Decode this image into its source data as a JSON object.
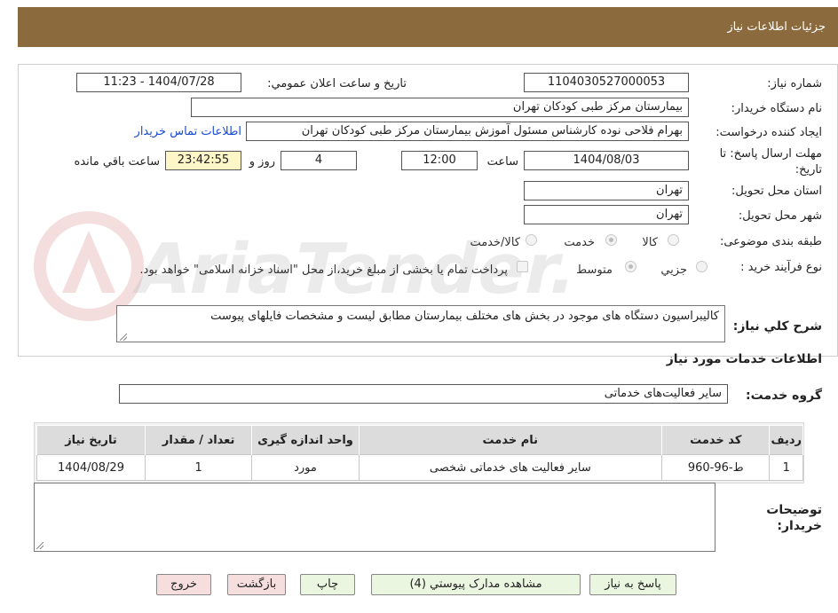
{
  "header": {
    "title": "جزئیات اطلاعات نیاز"
  },
  "form": {
    "need_number_label": "شماره نیاز:",
    "need_number": "1104030527000053",
    "announce_label": "تاريخ و ساعت اعلان عمومي:",
    "announce_value": "1404/07/28 - 11:23",
    "buyer_org_label": "نام دستگاه خريدار:",
    "buyer_org": "بیمارستان مرکز طبی کودکان تهران",
    "creator_label": "ايجاد کننده درخواست:",
    "creator": "بهرام فلاحی نوده کارشناس مسئول آموزش بیمارستان مرکز طبی کودکان تهران",
    "contact_link": "اطلاعات تماس خريدار",
    "deadline_label": "مهلت ارسال پاسخ: تا تاریخ:",
    "deadline_date": "1404/08/03",
    "hour_label": "ساعت",
    "deadline_time": "12:00",
    "days_value": "4",
    "days_label": "روز و",
    "remaining_time": "23:42:55",
    "remaining_label": "ساعت باقي مانده",
    "province_label": "استان محل تحویل:",
    "province": "تهران",
    "city_label": "شهر محل تحویل:",
    "city": "تهران",
    "category_label": "طبقه بندی موضوعی:",
    "category_options": [
      "کالا",
      "خدمت",
      "کالا/خدمت"
    ],
    "category_selected": "خدمت",
    "process_label": "نوع فرآیند خرید :",
    "process_options": [
      "جزيي",
      "متوسط"
    ],
    "process_selected": "متوسط",
    "payment_note": "پرداخت تمام یا بخشی از مبلغ خرید،از محل \"اسناد خزانه اسلامی\" خواهد بود."
  },
  "description": {
    "label": "شرح کلي نياز:",
    "text": "کالیبراسیون دستگاه های موجود در بخش های مختلف بیمارستان مطابق لیست و مشخصات فایلهای پیوست"
  },
  "services": {
    "section_title": "اطلاعات خدمات مورد نياز",
    "group_label": "گروه خدمت:",
    "group_value": "سایر فعالیت‌های خدماتی",
    "columns": [
      "رديف",
      "کد خدمت",
      "نام خدمت",
      "واحد اندازه گيری",
      "تعداد / مقدار",
      "تاريخ نياز"
    ],
    "rows": [
      [
        "1",
        "ط-96-960",
        "سایر فعالیت های خدماتی شخصی",
        "مورد",
        "1",
        "1404/08/29"
      ]
    ]
  },
  "notes": {
    "label": "توضيحات خريدار:",
    "value": ""
  },
  "buttons": {
    "reply": "پاسخ به نیاز",
    "documents": "مشاهده مدارک پیوستي (4)",
    "print": "چاپ",
    "back": "بازگشت",
    "exit": "خروج"
  },
  "watermark": {
    "text": "AriaTender.neT"
  },
  "colors": {
    "header": "#8B6A3E",
    "link": "#1a4bd1",
    "highlight": "#fff6c8",
    "button_green": "#eaf6e0",
    "button_pink": "#f7dede"
  }
}
